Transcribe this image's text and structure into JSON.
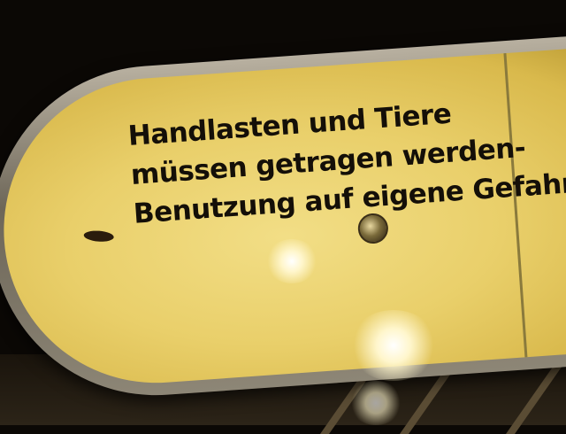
{
  "sign": {
    "line1": "Handlasten und Tiere",
    "line2": "müssen getragen werden-",
    "line3": "Benutzung auf eigene Gefahr."
  },
  "colors": {
    "sign_face": "#e9cf6a",
    "text": "#140f08",
    "frame": "#8d8676",
    "background": "#0b0805"
  }
}
